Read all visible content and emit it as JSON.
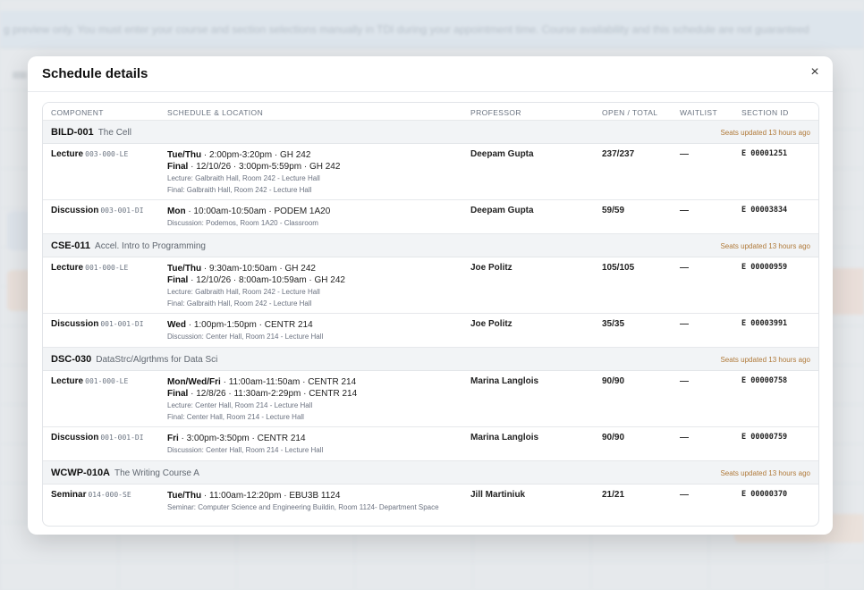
{
  "background": {
    "notice": "g preview only. You must enter your course and section selections manually in TDI during your appointment time. Course availability and this schedule are not guaranteed"
  },
  "modal": {
    "title": "Schedule details",
    "close_label": "×",
    "columns": [
      "COMPONENT",
      "SCHEDULE & LOCATION",
      "PROFESSOR",
      "OPEN / TOTAL",
      "WAITLIST",
      "SECTION ID"
    ],
    "courses": [
      {
        "code": "BILD-001",
        "name": "The Cell",
        "seats_note": "Seats updated 13 hours ago",
        "sections": [
          {
            "component": "Lecture",
            "section": "003-000-LE",
            "schedule": [
              {
                "label": "Tue/Thu",
                "text": " · 2:00pm-3:20pm · GH 242"
              },
              {
                "label": "Final",
                "text": " · 12/10/26 · 3:00pm-5:59pm · GH 242"
              }
            ],
            "locations": [
              "Lecture: Galbraith Hall, Room 242 - Lecture Hall",
              "Final: Galbraith Hall, Room 242 - Lecture Hall"
            ],
            "professor": "Deepam Gupta",
            "open_total": "237/237",
            "waitlist": "—",
            "section_id": "E 00001251"
          },
          {
            "component": "Discussion",
            "section": "003-001-DI",
            "schedule": [
              {
                "label": "Mon",
                "text": " · 10:00am-10:50am · PODEM 1A20"
              }
            ],
            "locations": [
              "Discussion: Podemos, Room 1A20 - Classroom"
            ],
            "professor": "Deepam Gupta",
            "open_total": "59/59",
            "waitlist": "—",
            "section_id": "E 00003834"
          }
        ]
      },
      {
        "code": "CSE-011",
        "name": "Accel. Intro to Programming",
        "seats_note": "Seats updated 13 hours ago",
        "sections": [
          {
            "component": "Lecture",
            "section": "001-000-LE",
            "schedule": [
              {
                "label": "Tue/Thu",
                "text": " · 9:30am-10:50am · GH 242"
              },
              {
                "label": "Final",
                "text": " · 12/10/26 · 8:00am-10:59am · GH 242"
              }
            ],
            "locations": [
              "Lecture: Galbraith Hall, Room 242 - Lecture Hall",
              "Final: Galbraith Hall, Room 242 - Lecture Hall"
            ],
            "professor": "Joe Politz",
            "open_total": "105/105",
            "waitlist": "—",
            "section_id": "E 00000959"
          },
          {
            "component": "Discussion",
            "section": "001-001-DI",
            "schedule": [
              {
                "label": "Wed",
                "text": " · 1:00pm-1:50pm · CENTR 214"
              }
            ],
            "locations": [
              "Discussion: Center Hall, Room 214 - Lecture Hall"
            ],
            "professor": "Joe Politz",
            "open_total": "35/35",
            "waitlist": "—",
            "section_id": "E 00003991"
          }
        ]
      },
      {
        "code": "DSC-030",
        "name": "DataStrc/Algrthms for Data Sci",
        "seats_note": "Seats updated 13 hours ago",
        "sections": [
          {
            "component": "Lecture",
            "section": "001-000-LE",
            "schedule": [
              {
                "label": "Mon/Wed/Fri",
                "text": " · 11:00am-11:50am · CENTR 214"
              },
              {
                "label": "Final",
                "text": " · 12/8/26 · 11:30am-2:29pm · CENTR 214"
              }
            ],
            "locations": [
              "Lecture: Center Hall, Room 214 - Lecture Hall",
              "Final: Center Hall, Room 214 - Lecture Hall"
            ],
            "professor": "Marina Langlois",
            "open_total": "90/90",
            "waitlist": "—",
            "section_id": "E 00000758"
          },
          {
            "component": "Discussion",
            "section": "001-001-DI",
            "schedule": [
              {
                "label": "Fri",
                "text": " · 3:00pm-3:50pm · CENTR 214"
              }
            ],
            "locations": [
              "Discussion: Center Hall, Room 214 - Lecture Hall"
            ],
            "professor": "Marina Langlois",
            "open_total": "90/90",
            "waitlist": "—",
            "section_id": "E 00000759"
          }
        ]
      },
      {
        "code": "WCWP-010A",
        "name": "The Writing Course A",
        "seats_note": "Seats updated 13 hours ago",
        "sections": [
          {
            "component": "Seminar",
            "section": "014-000-SE",
            "schedule": [
              {
                "label": "Tue/Thu",
                "text": " · 11:00am-12:20pm · EBU3B 1124"
              }
            ],
            "locations": [
              "Seminar: Computer Science and Engineering Buildin, Room 1124- Department Space"
            ],
            "professor": "Jill Martiniuk",
            "open_total": "21/21",
            "waitlist": "—",
            "section_id": "E 00000370"
          }
        ]
      }
    ]
  }
}
